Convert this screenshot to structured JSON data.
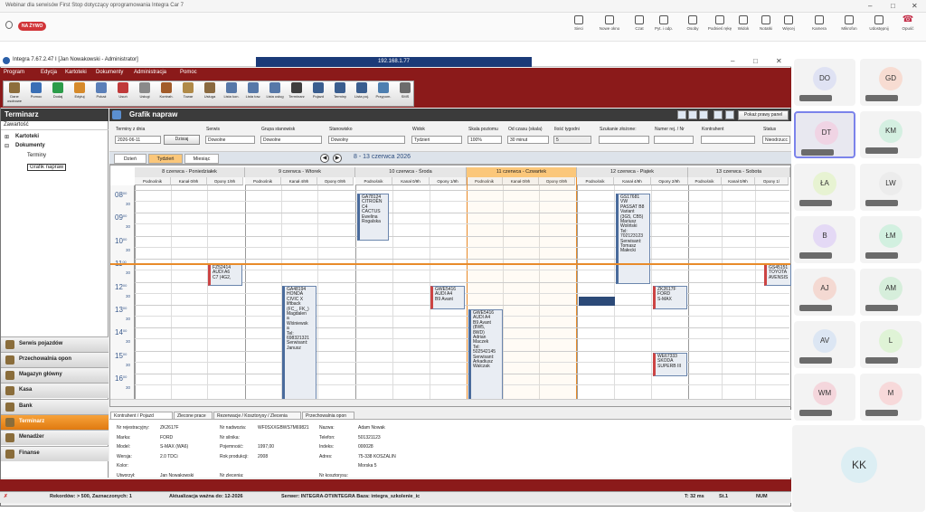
{
  "teams": {
    "window_title": "Webinar dla serwisów First Stop dotyczący oprogramowania Integra Car 7",
    "live_badge": "NA ŻYWO",
    "toolbar": [
      {
        "label": "Sieci"
      },
      {
        "label": "Nowe okno"
      },
      {
        "label": "Czat"
      },
      {
        "label": "Pyt. i odp."
      },
      {
        "label": "Osoby"
      },
      {
        "label": "Podnieś rękę"
      },
      {
        "label": "Widok"
      },
      {
        "label": "Notatki"
      },
      {
        "label": "Więcej"
      },
      {
        "label": "Kamera"
      },
      {
        "label": "Mikrofon"
      },
      {
        "label": "Udostępnij"
      }
    ],
    "leave_label": "Opuść",
    "participants": [
      {
        "initials": "DO",
        "color": "#dfe2f3"
      },
      {
        "initials": "GD",
        "color": "#f7dcd2"
      },
      {
        "initials": "DT",
        "color": "#f0d4e4"
      },
      {
        "initials": "KM",
        "color": "#d4efe1"
      },
      {
        "initials": "ŁA",
        "color": "#e7f3d2"
      },
      {
        "initials": "LW",
        "color": "#ececec"
      },
      {
        "initials": "B",
        "color": "#e4d9f5"
      },
      {
        "initials": "ŁM",
        "color": "#d2f0e0"
      },
      {
        "initials": "AJ",
        "color": "#f4d9d2"
      },
      {
        "initials": "AM",
        "color": "#d6eedb"
      },
      {
        "initials": "AV",
        "color": "#dce6f3"
      },
      {
        "initials": "L",
        "color": "#dff3d6"
      },
      {
        "initials": "WM",
        "color": "#f4d6dc"
      },
      {
        "initials": "M",
        "color": "#f7d9da"
      }
    ],
    "self_initials": "KK"
  },
  "app": {
    "title": "Integra 7.67.2.47 I [Jan Nowakowski - Administrator]",
    "remote_ip": "192.168.1.77",
    "menu": [
      "Program",
      "Edycja",
      "Kartoteki",
      "Dokumenty",
      "Administracja",
      "Pomoc"
    ],
    "tools": [
      "Dane osobowe",
      "Pomoc",
      "Dodaj",
      "Edytuj",
      "Pokaż",
      "Usuń",
      "Usługi",
      "Kontrah.",
      "Towar",
      "Usługa",
      "Lista kon.",
      "Lista tow.",
      "Lista usług",
      "Terminarz",
      "Pojazd",
      "Terminy",
      "Lista poj.",
      "Przypom.",
      "SMS"
    ],
    "left": {
      "header": "Terminarz",
      "subheader": "Zawartość",
      "tree": [
        "Kartoteki",
        "Dokumenty",
        "Terminy",
        "Grafik napraw"
      ],
      "nav": [
        "Serwis pojazdów",
        "Przechowalnia opon",
        "Magazyn główny",
        "Kasa",
        "Bank",
        "Terminarz",
        "Menadżer",
        "Finanse"
      ]
    },
    "main_title": "Grafik napraw",
    "show_panel": "Pokaż prawy panel",
    "filters": {
      "date_label": "Terminy z dnia",
      "date_value": "2026-06-11",
      "today_button": "Dzisiaj",
      "service_label": "Serwis",
      "service_value": "Dowolne",
      "group_label": "Grupa stanowisk",
      "group_value": "Dowolne",
      "station_label": "Stanowisko",
      "station_value": "Dowolny",
      "view_label": "Widok",
      "view_value": "Tydzień",
      "scale_label": "Skala poziomu",
      "scale_value": "100%",
      "interval_label": "Od czasu (skala)",
      "interval_value": "30 minut",
      "weeks_label": "Ilość tygodni",
      "weeks_value": "5",
      "search_label": "Szukanie złożone:",
      "regno_label": "Numer rej. / Nr",
      "contractor_label": "Kontrahent",
      "status_label": "Status",
      "status_value": "Nieodrzucc"
    },
    "view_tabs": [
      "Dzień",
      "Tydzień",
      "Miesiąc"
    ],
    "range_title": "8 - 13 czerwca 2026",
    "days": [
      "8 czerwca - Poniedziałek",
      "9 czerwca - Wtorek",
      "10 czerwca - Środa",
      "11 czerwca - Czwartek",
      "12 czerwca - Piątek",
      "13 czerwca - Sobota"
    ],
    "columns": [
      [
        "Podnośnik",
        "Kanał 0/9h",
        "Opony 1/9h"
      ],
      [
        "Podnośnik",
        "Kanał 4/9h",
        "Opony 0/9h"
      ],
      [
        "Podnośnik",
        "Kanał 0/9h",
        "Opony 1/9h"
      ],
      [
        "Podnośnik",
        "Kanał 0/9h",
        "Opony 0/9h"
      ],
      [
        "Podnośnik",
        "Kanał 4/9h",
        "Opony 2/9h"
      ],
      [
        "Podnośnik",
        "Kanał 0/9h",
        "Opony 1/"
      ]
    ],
    "hours": [
      "08",
      "09",
      "10",
      "11",
      "12",
      "13",
      "14",
      "15",
      "16"
    ],
    "half": "30",
    "half_zero": "00",
    "appointments": [
      {
        "text": "GA78124\nCITROËN\nC4\nCACTUS\nEwelina\nRogalska"
      },
      {
        "text": "GS17681\nVW\nPASSAT B8\nVariant\n(3G5, CB5)\nMariusz\nWoliński\nTel:\n702123123\nSerwisant:\nTomasz\nMałecki"
      },
      {
        "text": "FZ52414\nAUDI A6\nC7 (4G2,"
      },
      {
        "text": "GA48194\nHONDA\nCIVIC X\nliftback\n(FC_, FK_)\nMagdalen\na\nWiśniewsk\na\nTel:\n698321321\nSerwisant:\nJanusz"
      },
      {
        "text": "GWE5416\nAUDI A4\nB9 Avant"
      },
      {
        "text": "GWE5416\nAUDI A4\nB9 Avant\n(8W5,\n8WD)\nAdrian\nMaczek\nTel:\n502542145\nSerwisant:\nArkadiusz\nWalczak"
      },
      {
        "text": "ZK2617F\nFORD\nS-MAX"
      },
      {
        "text": "WE67333\nSKODA\nSUPERB III"
      },
      {
        "text": "GS45151\nTOYOTA\nAVENSIS"
      }
    ],
    "detail_tabs": [
      "Kontrahent / Pojazd",
      "Zlecone prace",
      "Rezerwacje / Kosztorysy / Zlecenia",
      "Przechowalnia opon"
    ],
    "details": {
      "col1": [
        [
          "Nr rejestracyjny:",
          "ZK2617F"
        ],
        [
          "Marka:",
          "FORD"
        ],
        [
          "Model:",
          "S-MAX (WA6)"
        ],
        [
          "Wersja:",
          "2.0 TDCi"
        ],
        [
          "Kolor:",
          ""
        ],
        [
          "Utworzył:",
          "Jan Nowakowski"
        ]
      ],
      "col2": [
        [
          "Nr nadwozia:",
          "WF0SXXGBWS7M69821"
        ],
        [
          "Nr silnika:",
          ""
        ],
        [
          "Pojemność:",
          "1997,00"
        ],
        [
          "Rok produkcji:",
          "2008"
        ],
        [
          "",
          ""
        ],
        [
          "Nr zlecenia:",
          ""
        ]
      ],
      "col3": [
        [
          "Nazwa:",
          "Adam Nowak"
        ],
        [
          "Telefon:",
          "501321123"
        ],
        [
          "Indeks:",
          "000028"
        ],
        [
          "Adres:",
          "75-338 KOSZALIN"
        ],
        [
          "",
          "Morska 5"
        ],
        [
          "Nr kosztorysu:",
          ""
        ]
      ]
    },
    "status": {
      "records": "Rekordów: > 500, Zaznaczonych: 1",
      "update": "Aktualizacja ważna do: 12-2026",
      "server": "Serwer: INTEGRA-DT\\INTEGRA  Baza: integra_szkolenie_ic",
      "time": "T: 32 ms",
      "st": "St.1",
      "num": "NUM"
    }
  }
}
